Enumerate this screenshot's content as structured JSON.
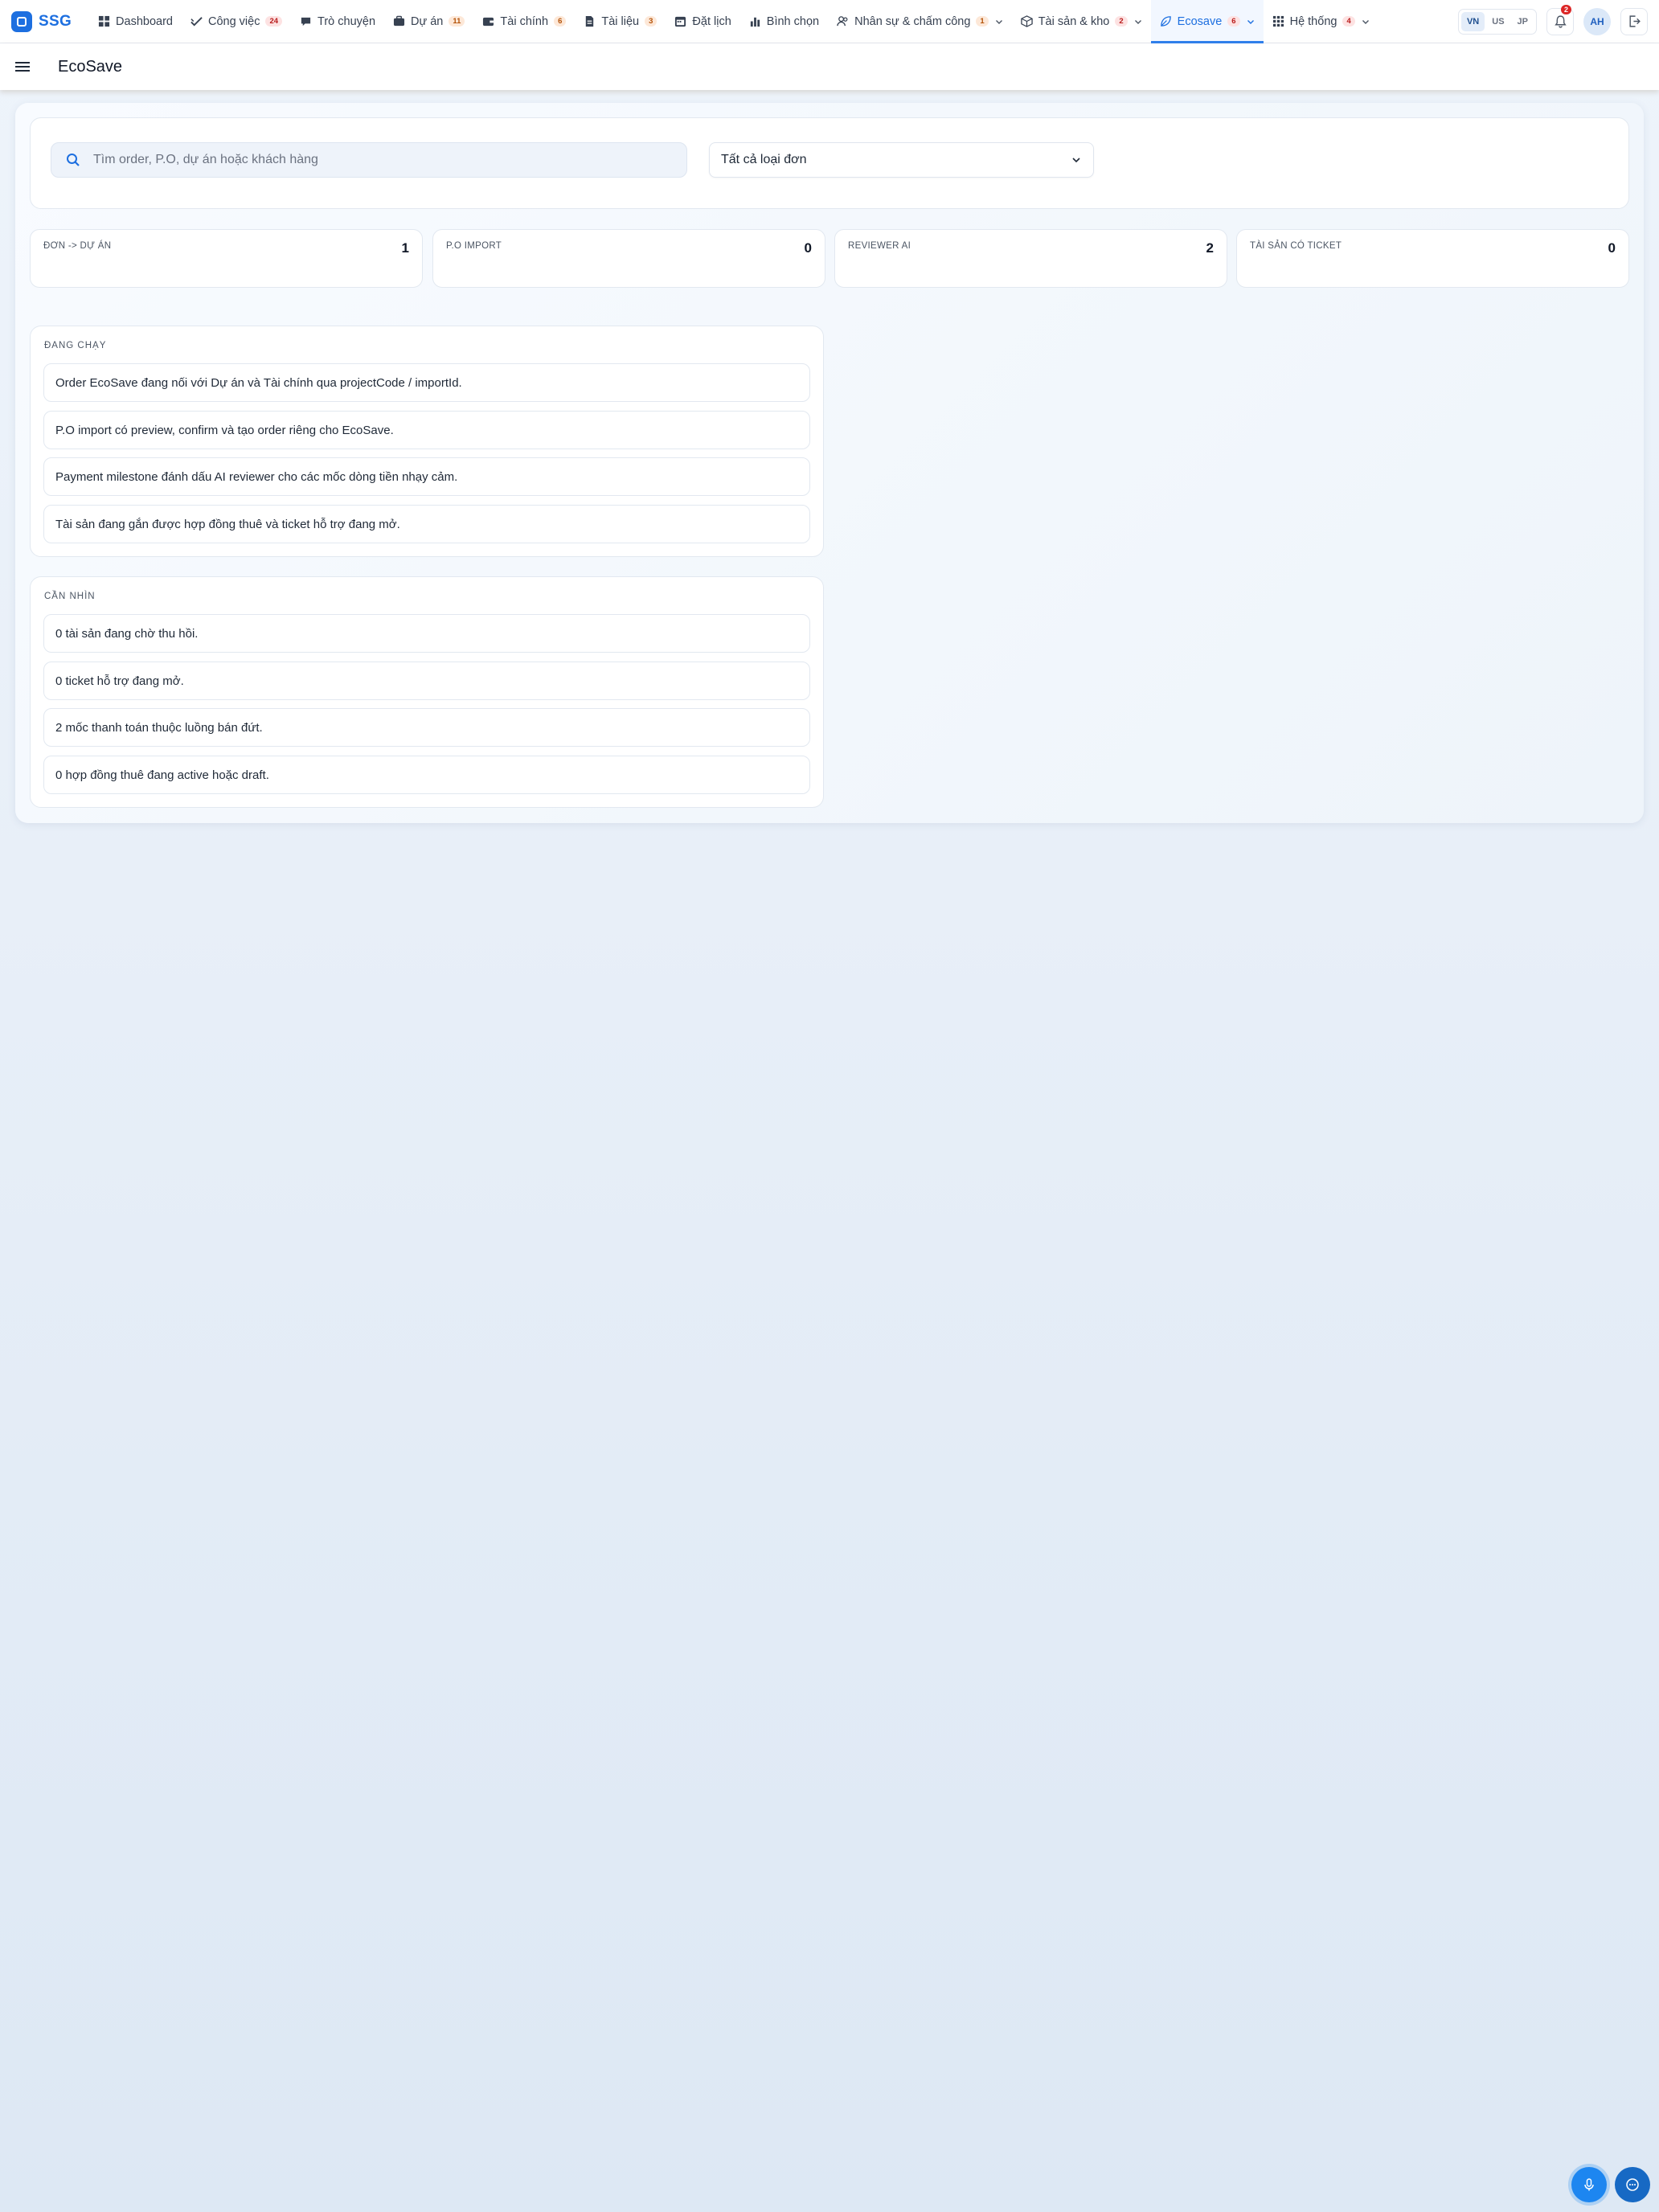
{
  "brand": {
    "name": "SSG"
  },
  "nav": {
    "items": [
      {
        "label": "Dashboard",
        "icon": "grid-icon",
        "badge": ""
      },
      {
        "label": "Công việc",
        "icon": "check-icon",
        "badge": "24"
      },
      {
        "label": "Trò chuyện",
        "icon": "chat-icon",
        "badge": ""
      },
      {
        "label": "Dự án",
        "icon": "briefcase-icon",
        "badge": "11"
      },
      {
        "label": "Tài chính",
        "icon": "wallet-icon",
        "badge": "6"
      },
      {
        "label": "Tài liệu",
        "icon": "document-icon",
        "badge": "3"
      },
      {
        "label": "Đặt lịch",
        "icon": "calendar-icon",
        "badge": ""
      },
      {
        "label": "Bình chọn",
        "icon": "bar-chart-icon",
        "badge": ""
      },
      {
        "label": "Nhân sự & chấm công",
        "icon": "users-icon",
        "badge": "1"
      },
      {
        "label": "Tài sản & kho",
        "icon": "box-icon",
        "badge": "2"
      },
      {
        "label": "Ecosave",
        "icon": "leaf-icon",
        "badge": "6"
      },
      {
        "label": "Hệ thống",
        "icon": "apps-icon",
        "badge": "4"
      }
    ],
    "languages": [
      "VN",
      "US",
      "JP"
    ],
    "active_language": "VN",
    "notification_count": "2",
    "avatar_initials": "AH"
  },
  "header": {
    "title": "EcoSave"
  },
  "filters": {
    "search_placeholder": "Tìm order, P.O, dự án hoặc khách hàng",
    "type_select": "Tất cả loại đơn"
  },
  "stats": [
    {
      "label": "ĐƠN -> DỰ ÁN",
      "value": "1"
    },
    {
      "label": "P.O IMPORT",
      "value": "0"
    },
    {
      "label": "REVIEWER AI",
      "value": "2"
    },
    {
      "label": "TÀI SẢN CÓ TICKET",
      "value": "0"
    }
  ],
  "running": {
    "title": "ĐANG CHẠY",
    "items": [
      "Order EcoSave đang nối với Dự án và Tài chính qua projectCode / importId.",
      "P.O import có preview, confirm và tạo order riêng cho EcoSave.",
      "Payment milestone đánh dấu AI reviewer cho các mốc dòng tiền nhạy cảm.",
      "Tài sản đang gắn được hợp đồng thuê và ticket hỗ trợ đang mở."
    ]
  },
  "attention": {
    "title": "CẦN NHÌN",
    "items": [
      "0 tài sản đang chờ thu hồi.",
      "0 ticket hỗ trợ đang mở.",
      "2 mốc thanh toán thuộc luồng bán đứt.",
      "0 hợp đồng thuê đang active hoặc draft."
    ]
  },
  "colors": {
    "accent": "#1d6fe0",
    "active_tab": "#2f80ed",
    "badge_red": "#dc2626"
  }
}
